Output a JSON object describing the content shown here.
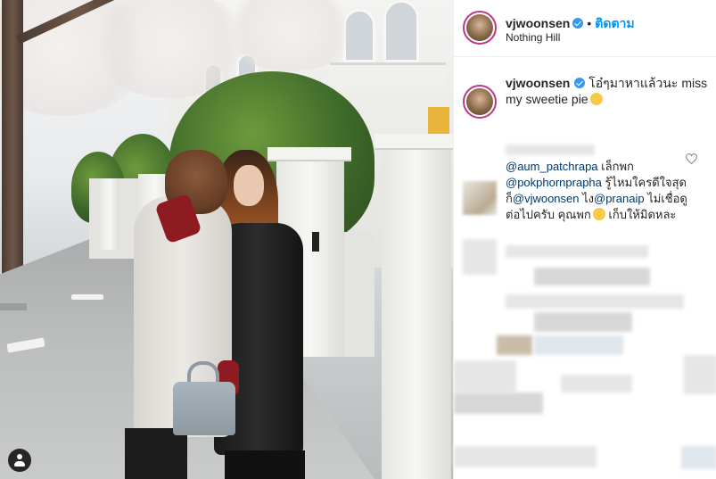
{
  "post": {
    "username": "vjwoonsen",
    "follow_label": "ติดตาม",
    "location": "Nothing Hill",
    "caption_text": "โอ๋ๆมาหาแล้วนะ miss my sweetie pie"
  },
  "comments": [
    {
      "mention_1": "@aum_patchrapa",
      "text_1": " เล็กพก ",
      "mention_2": "@pokphornprapha",
      "text_2": " รู้ไหมใครดีใจสุด ก็",
      "mention_3": "@vjwoonsen",
      "text_3": " ไง",
      "mention_4": "@pranaip",
      "text_4": " ไม่เชื่อดูต่อไปครับ คุณพก",
      "text_5": " เก็บให้มิดหละ"
    }
  ],
  "icons": {
    "verified": "verified-badge-icon",
    "heart": "heart-icon",
    "user_tag": "user-tag-icon",
    "emoji": "smiling-emoji-icon"
  },
  "colors": {
    "follow": "#0095f6",
    "mention": "#00376b",
    "verified": "#3897f0",
    "avatar_ring": "#c13584"
  }
}
